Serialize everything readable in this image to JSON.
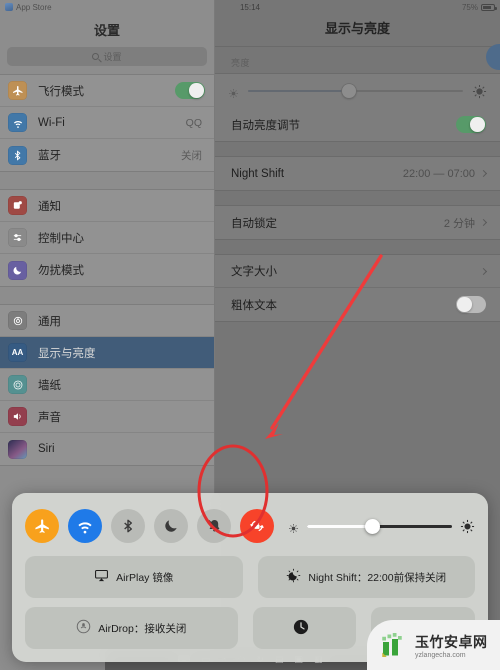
{
  "statusbar": {
    "app_label": "App Store",
    "time": "15:14",
    "battery": "75%"
  },
  "sidebar": {
    "title": "设置",
    "search_placeholder": "设置",
    "groups": [
      {
        "items": [
          {
            "label": "飞行模式",
            "icon": "airplane-icon",
            "icon_color": "#e08b20",
            "control": "toggle",
            "toggle_on": true
          },
          {
            "label": "Wi-Fi",
            "icon": "wifi-icon",
            "icon_color": "#1c7fd6",
            "control": "value",
            "value": "QQ"
          },
          {
            "label": "蓝牙",
            "icon": "bluetooth-icon",
            "icon_color": "#1c7fd6",
            "control": "value",
            "value": "关闭"
          }
        ]
      },
      {
        "items": [
          {
            "label": "通知",
            "icon": "notifications-icon",
            "icon_color": "#d63b33",
            "control": "none"
          },
          {
            "label": "控制中心",
            "icon": "control-center-icon",
            "icon_color": "#8a8a8a",
            "control": "none"
          },
          {
            "label": "勿扰模式",
            "icon": "do-not-disturb-icon",
            "icon_color": "#6a5bd0",
            "control": "none"
          }
        ]
      },
      {
        "items": [
          {
            "label": "通用",
            "icon": "general-gear-icon",
            "icon_color": "#7d7d7d",
            "control": "none"
          },
          {
            "label": "显示与亮度",
            "icon": "display-brightness-icon",
            "icon_color": "#1c5fa8",
            "control": "none",
            "selected": true
          },
          {
            "label": "墙纸",
            "icon": "wallpaper-icon",
            "icon_color": "#2e9b9b",
            "control": "none"
          },
          {
            "label": "声音",
            "icon": "sound-icon",
            "icon_color": "#c8304a",
            "control": "none"
          },
          {
            "label": "Siri",
            "icon": "siri-icon",
            "icon_color": "#2a2a6e",
            "control": "none"
          }
        ]
      }
    ]
  },
  "detail": {
    "title": "显示与亮度",
    "brightness_section_label": "亮度",
    "brightness_percent": 47,
    "auto_brightness": {
      "label": "自动亮度调节",
      "toggle_on": true
    },
    "rows": [
      {
        "label": "Night Shift",
        "value": "22:00 — 07:00",
        "chevron": true
      },
      {
        "label": "自动锁定",
        "value": "2 分钟",
        "chevron": true
      },
      {
        "label": "文字大小",
        "value": "",
        "chevron": true
      },
      {
        "label": "粗体文本",
        "value": "",
        "chevron": false,
        "toggle": true,
        "toggle_on": false
      }
    ]
  },
  "control_center": {
    "buttons": [
      {
        "name": "airplane-mode",
        "icon": "airplane-icon",
        "state": "on"
      },
      {
        "name": "wifi",
        "icon": "wifi-icon",
        "state": "on"
      },
      {
        "name": "bluetooth",
        "icon": "bluetooth-icon",
        "state": "off"
      },
      {
        "name": "do-not-disturb",
        "icon": "moon-icon",
        "state": "off"
      },
      {
        "name": "mute",
        "icon": "bell-slash-icon",
        "state": "off"
      },
      {
        "name": "rotation-lock",
        "icon": "rotation-lock-icon",
        "state": "on"
      }
    ],
    "brightness_percent": 45,
    "airplay_label": "AirPlay 镜像",
    "night_shift_label": "Night Shift：22:00前保持关闭",
    "airdrop_label": "AirDrop：接收关闭",
    "timer_label": "",
    "camera_label": ""
  },
  "annotations": {
    "highlight_color": "#e03030",
    "circle_target": "rotation-lock-button",
    "arrow_from": "文字大小 区域",
    "arrow_to": "rotation-lock-button"
  },
  "watermark": {
    "text_cn": "玉竹安卓网",
    "text_en": "yzlangecha.com",
    "color": "#4caf50"
  }
}
